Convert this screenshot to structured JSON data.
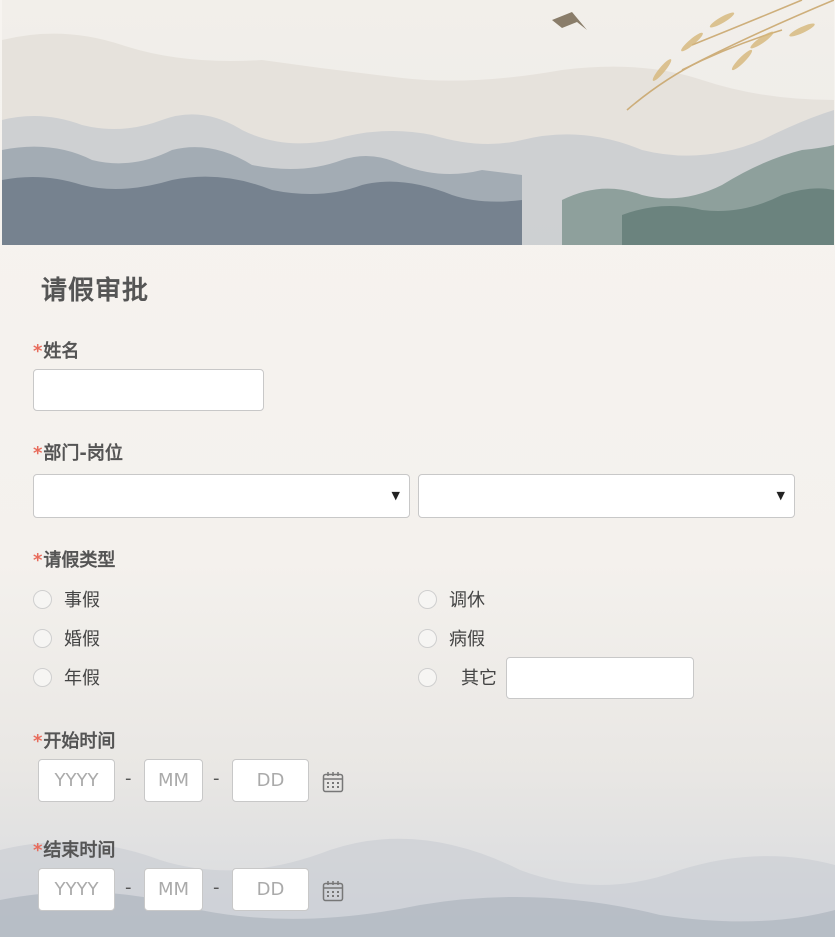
{
  "form": {
    "title": "请假审批",
    "required_mark": "*",
    "name": {
      "label": "姓名",
      "value": ""
    },
    "dept": {
      "label": "部门-岗位",
      "department_value": "",
      "position_value": ""
    },
    "leave_type": {
      "label": "请假类型",
      "options": [
        "事假",
        "调休",
        "婚假",
        "病假",
        "年假",
        "其它"
      ],
      "other_value": ""
    },
    "start": {
      "label": "开始时间",
      "year_placeholder": "YYYY",
      "month_placeholder": "MM",
      "day_placeholder": "DD",
      "separator": "-"
    },
    "end": {
      "label": "结束时间",
      "year_placeholder": "YYYY",
      "month_placeholder": "MM",
      "day_placeholder": "DD",
      "separator": "-"
    }
  },
  "icons": {
    "select_arrow": "▼",
    "calendar": "calendar-icon"
  },
  "colors": {
    "required": "#e86c5c",
    "label": "#555555",
    "border": "#c8c8c8"
  }
}
